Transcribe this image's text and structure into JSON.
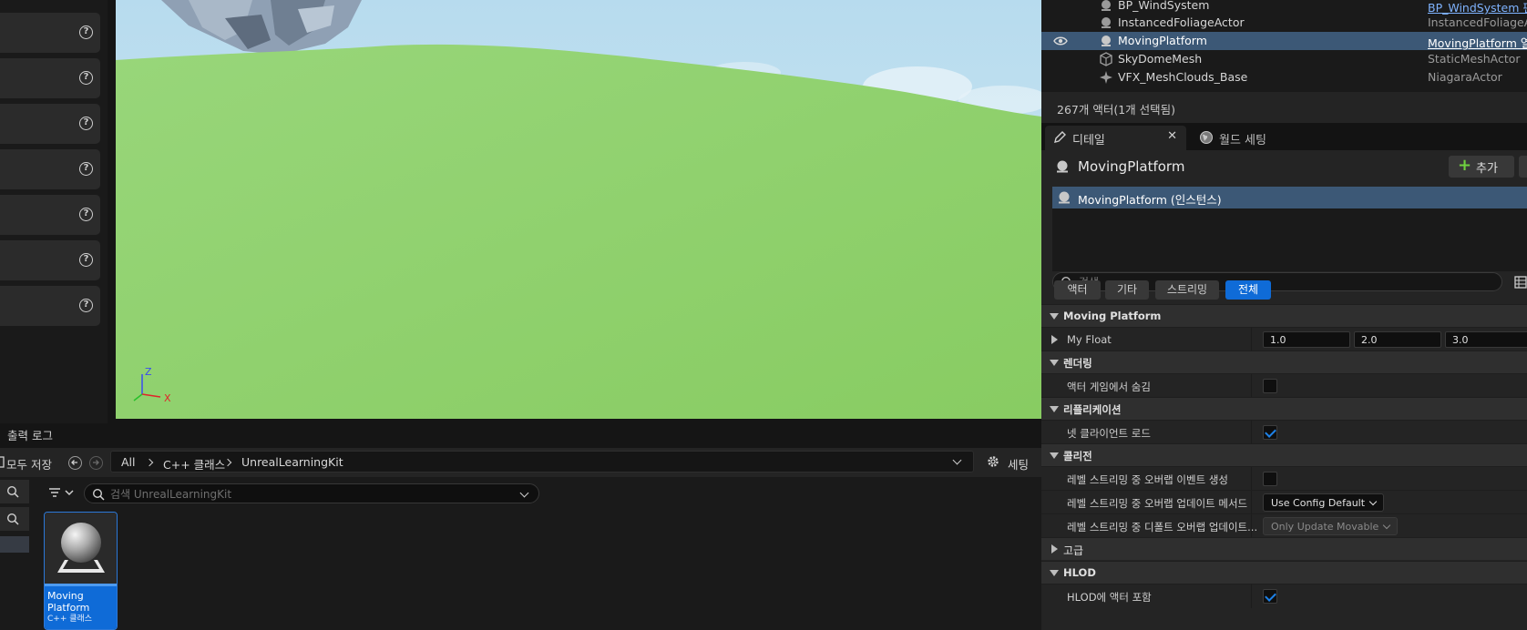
{
  "outliner": {
    "rows": [
      {
        "name": "BP_WindSystem",
        "type": "BP_WindSystem 편",
        "link": true
      },
      {
        "name": "InstancedFoliageActor",
        "type": "InstancedFoliageAc",
        "link": false
      },
      {
        "name": "MovingPlatform",
        "type": "MovingPlatform 열",
        "link": true,
        "selected": true
      },
      {
        "name": "SkyDomeMesh",
        "type": "StaticMeshActor",
        "link": false
      },
      {
        "name": "VFX_MeshClouds_Base",
        "type": "NiagaraActor",
        "link": false
      }
    ],
    "status": "267개 액터(1개 선택됨)"
  },
  "tabs": {
    "details": "디테일",
    "world_settings": "월드 세팅"
  },
  "details": {
    "actor_name": "MovingPlatform",
    "add_label": "추가",
    "component": "MovingPlatform (인스턴스)",
    "search_placeholder": "검색",
    "filters": [
      "액터",
      "기타",
      "스트리밍",
      "전체"
    ],
    "categories": {
      "moving_platform": "Moving Platform",
      "rendering": "렌더링",
      "replication": "리플리케이션",
      "collision": "콜리전",
      "advanced": "고급",
      "hlod": "HLOD"
    },
    "props": {
      "my_float": "My Float",
      "my_float_values": [
        "1.0",
        "2.0",
        "3.0"
      ],
      "hidden_in_game": "액터 게임에서 숨김",
      "net_load_on_client": "넷 클라이언트 로드",
      "gen_overlap_events": "레벨 스트리밍 중 오버랩 이벤트 생성",
      "overlap_update_method": "레벨 스트리밍 중 오버랩 업데이트 메서드",
      "overlap_update_method_value": "Use Config Default",
      "default_overlap_update": "레벨 스트리밍 중 디폴트 오버랩 업데이트...",
      "default_overlap_update_value": "Only Update Movable",
      "include_in_hlod": "HLOD에 액터 포함"
    }
  },
  "bottom": {
    "output_log": "출력 로그",
    "save_all": "모두 저장",
    "breadcrumb": [
      "All",
      "C++ 클래스",
      "UnrealLearningKit"
    ],
    "settings": "세팅",
    "search_placeholder": "검색 UnrealLearningKit",
    "asset": {
      "name_line1": "Moving",
      "name_line2": "Platform",
      "type": "C++ 클래스"
    }
  },
  "viewport": {
    "axis_z": "Z",
    "axis_x": "X"
  },
  "colors": {
    "selection": "#3c5876",
    "accent": "#0f6bd7",
    "grass": "#8ed170",
    "sky": "#c3e1f0"
  }
}
